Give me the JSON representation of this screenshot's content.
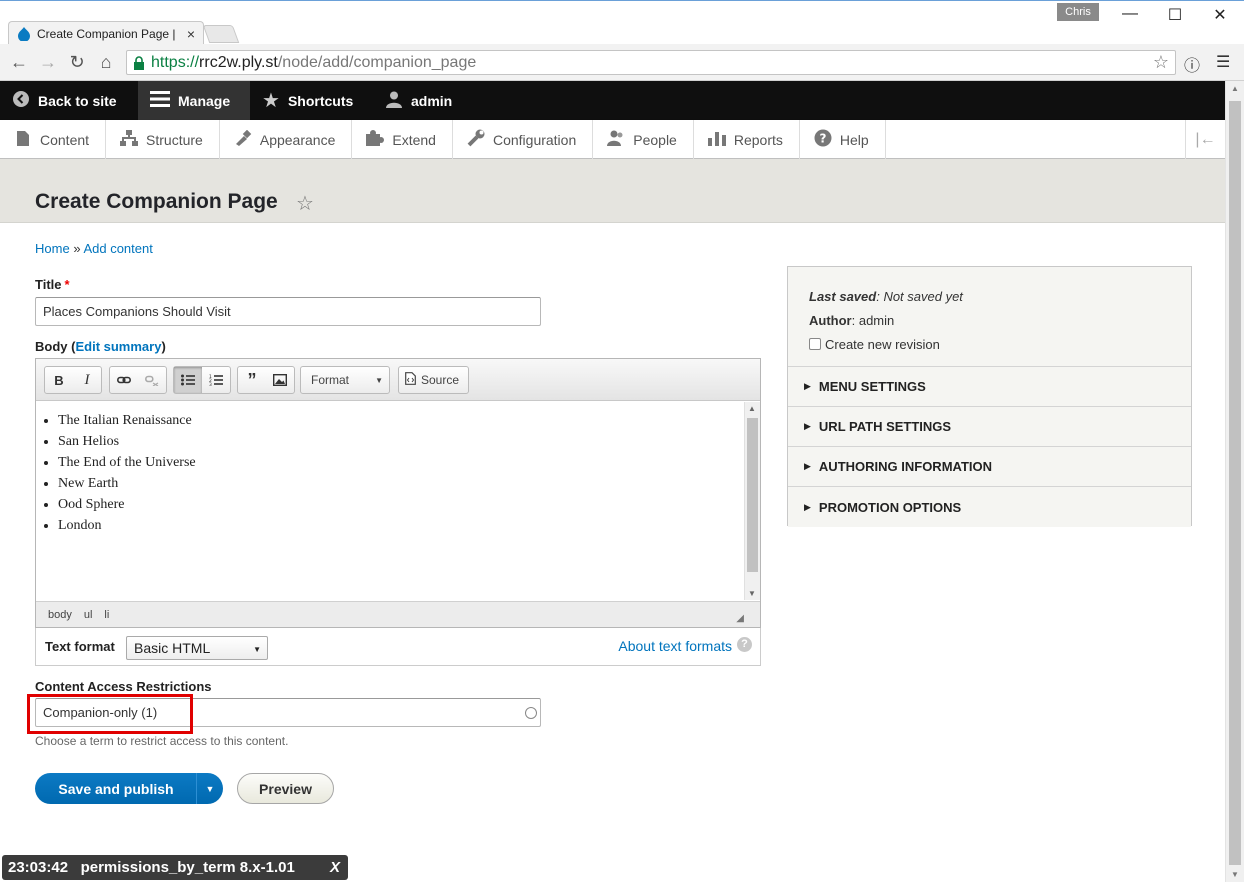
{
  "browser": {
    "tab_title": "Create Companion Page |",
    "tab_close": "×",
    "user_badge": "Chris",
    "url_scheme": "https://",
    "url_host": "rrc2w.ply.st",
    "url_path": "/node/add/companion_page"
  },
  "toolbar": {
    "back_label": "Back to site",
    "manage_label": "Manage",
    "shortcuts_label": "Shortcuts",
    "user_label": "admin"
  },
  "tray": {
    "items": [
      {
        "label": "Content",
        "icon": "file-icon"
      },
      {
        "label": "Structure",
        "icon": "sitemap-icon"
      },
      {
        "label": "Appearance",
        "icon": "paintbrush-icon"
      },
      {
        "label": "Extend",
        "icon": "puzzle-icon"
      },
      {
        "label": "Configuration",
        "icon": "wrench-icon"
      },
      {
        "label": "People",
        "icon": "people-icon"
      },
      {
        "label": "Reports",
        "icon": "bar-chart-icon"
      },
      {
        "label": "Help",
        "icon": "help-icon"
      }
    ]
  },
  "page": {
    "title": "Create Companion Page",
    "breadcrumb": {
      "home": "Home",
      "sep": "»",
      "add": "Add content"
    }
  },
  "form": {
    "title_label": "Title",
    "title_required": "*",
    "title_value": "Places Companions Should Visit",
    "body_label": "Body",
    "body_paren_open": "(",
    "body_link": "Edit summary",
    "body_paren_close": ")",
    "editor": {
      "format_label": "Format",
      "source_label": "Source",
      "items": [
        "The Italian Renaissance",
        "San Helios",
        "The End of the Universe",
        "New Earth",
        "Ood Sphere",
        "London"
      ],
      "path": [
        "body",
        "ul",
        "li"
      ]
    },
    "text_format_label": "Text format",
    "text_format_value": "Basic HTML",
    "about_formats": "About text formats",
    "car_label": "Content Access Restrictions",
    "car_value": "Companion-only (1)",
    "car_description": "Choose a term to restrict access to this content.",
    "save_label": "Save and publish",
    "preview_label": "Preview"
  },
  "sidebar": {
    "last_saved_label": "Last saved",
    "last_saved_value": "Not saved yet",
    "author_label": "Author",
    "author_value": "admin",
    "revision_label": "Create new revision",
    "sections": [
      "Menu settings",
      "URL path settings",
      "Authoring information",
      "Promotion options"
    ]
  },
  "overlay": {
    "time": "23:03:42",
    "label": "permissions_by_term 8.x-1.01",
    "close": "X"
  },
  "colors": {
    "accent": "#0074bd",
    "primary_button": "#0069b0",
    "highlight": "#e00000",
    "toolbar": "#0f0f0f"
  }
}
